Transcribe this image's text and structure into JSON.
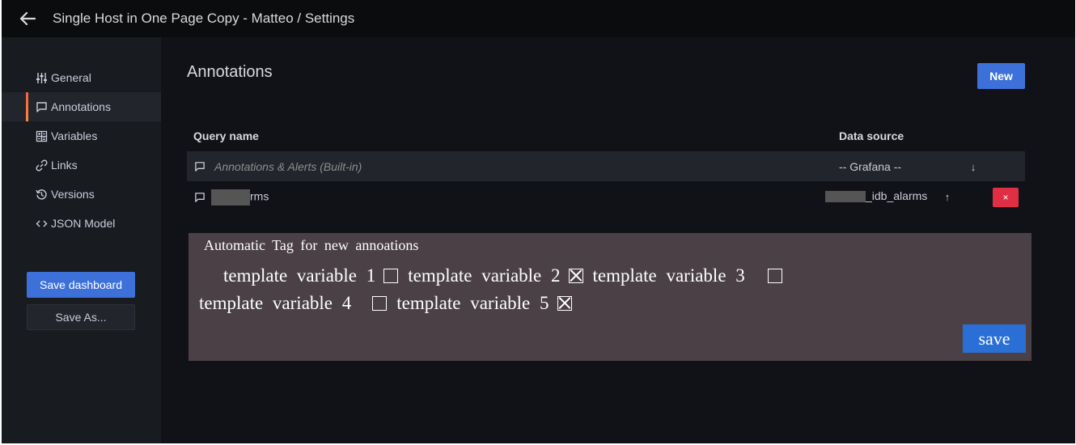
{
  "header": {
    "title": "Single Host in One Page Copy - Matteo / Settings"
  },
  "sidebar": {
    "items": [
      {
        "label": "General",
        "icon": "sliders-icon",
        "active": false
      },
      {
        "label": "Annotations",
        "icon": "comment-icon",
        "active": true
      },
      {
        "label": "Variables",
        "icon": "calculator-icon",
        "active": false
      },
      {
        "label": "Links",
        "icon": "link-icon",
        "active": false
      },
      {
        "label": "Versions",
        "icon": "history-icon",
        "active": false
      },
      {
        "label": "JSON Model",
        "icon": "code-icon",
        "active": false
      }
    ],
    "save_dashboard_label": "Save dashboard",
    "save_as_label": "Save As..."
  },
  "main": {
    "title": "Annotations",
    "new_button_label": "New",
    "table": {
      "columns": [
        "Query name",
        "Data source"
      ],
      "rows": [
        {
          "name": "Annotations & Alerts (Built-in)",
          "datasource": "-- Grafana --",
          "builtin": true
        },
        {
          "name": "rms",
          "datasource": "_idb_alarms",
          "builtin": false
        }
      ]
    },
    "delete_label": "×",
    "arrow_down": "↓",
    "arrow_up": "↑"
  },
  "tag_panel": {
    "title": "Automatic Tag for new annoations",
    "variables": [
      {
        "label": "template variable 1",
        "checked": false
      },
      {
        "label": "template variable 2",
        "checked": true
      },
      {
        "label": "template variable 3",
        "checked": false
      },
      {
        "label": "template variable 4",
        "checked": false
      },
      {
        "label": "template variable 5",
        "checked": true
      }
    ],
    "save_label": "save"
  },
  "colors": {
    "primary": "#3d71d9",
    "danger": "#e02f44",
    "active_border": "#ff8833",
    "panel_bg": "#4a4045"
  }
}
